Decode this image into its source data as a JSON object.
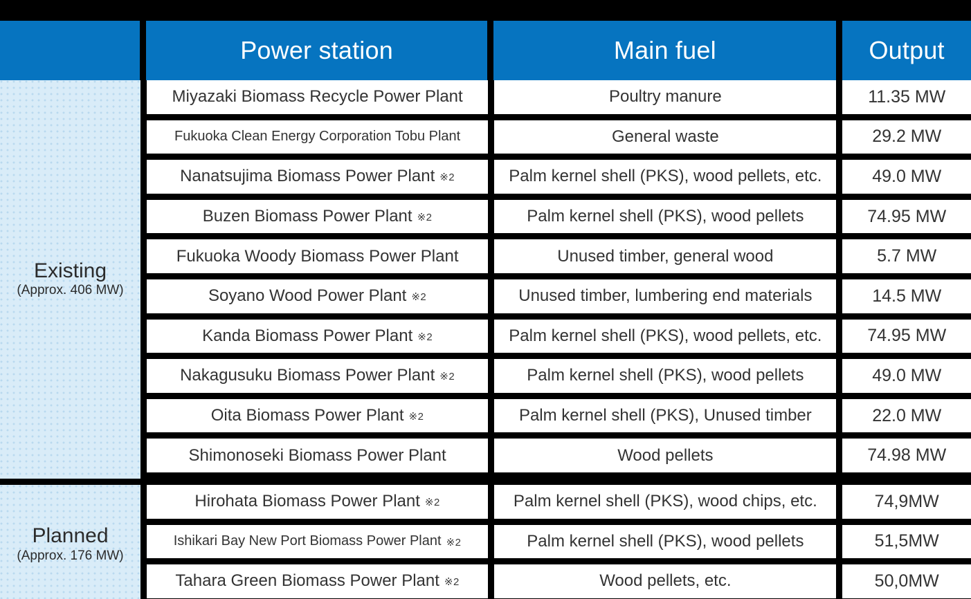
{
  "colors": {
    "header_blue": "#0674c0",
    "group_bg": "#d9ecf8",
    "grid_black": "#000000",
    "text_dark": "#333333"
  },
  "header": {
    "corner_label": "",
    "station_label": "Power station",
    "fuel_label": "Main fuel",
    "output_label": "Output"
  },
  "groups": [
    {
      "id": "existing",
      "name": "Existing",
      "subtitle": "(Approx. 406 MW)",
      "row_count": 10
    },
    {
      "id": "planned",
      "name": "Planned",
      "subtitle": "(Approx. 176 MW)",
      "row_count": 3
    }
  ],
  "rows": [
    {
      "group": "existing",
      "station": "Miyazaki Biomass Recycle Power Plant",
      "note": "",
      "fuel": "Poultry manure",
      "output": "11.35 MW"
    },
    {
      "group": "existing",
      "station": "Fukuoka Clean Energy Corporation Tobu Plant",
      "note": "",
      "fuel": "General waste",
      "output": "29.2 MW"
    },
    {
      "group": "existing",
      "station": "Nanatsujima Biomass Power Plant",
      "note": "※2",
      "fuel": "Palm kernel shell (PKS), wood pellets, etc.",
      "output": "49.0 MW"
    },
    {
      "group": "existing",
      "station": "Buzen Biomass Power Plant",
      "note": "※2",
      "fuel": "Palm kernel shell (PKS), wood pellets",
      "output": "74.95 MW"
    },
    {
      "group": "existing",
      "station": "Fukuoka Woody Biomass Power Plant",
      "note": "",
      "fuel": "Unused timber, general wood",
      "output": "5.7 MW"
    },
    {
      "group": "existing",
      "station": "Soyano Wood Power Plant",
      "note": "※2",
      "fuel": "Unused timber, lumbering end materials",
      "output": "14.5 MW"
    },
    {
      "group": "existing",
      "station": "Kanda Biomass Power Plant",
      "note": "※2",
      "fuel": "Palm kernel shell (PKS), wood pellets, etc.",
      "output": "74.95 MW"
    },
    {
      "group": "existing",
      "station": "Nakagusuku Biomass Power Plant",
      "note": "※2",
      "fuel": "Palm kernel shell (PKS), wood pellets",
      "output": "49.0 MW"
    },
    {
      "group": "existing",
      "station": "Oita Biomass Power Plant",
      "note": "※2",
      "fuel": "Palm kernel shell (PKS), Unused timber",
      "output": "22.0 MW"
    },
    {
      "group": "existing",
      "station": "Shimonoseki Biomass Power Plant",
      "note": "",
      "fuel": "Wood pellets",
      "output": "74.98 MW"
    },
    {
      "group": "planned",
      "station": "Hirohata Biomass Power Plant",
      "note": "※2",
      "fuel": "Palm kernel shell (PKS), wood chips, etc.",
      "output": "74,9MW"
    },
    {
      "group": "planned",
      "station": "Ishikari Bay New Port Biomass Power Plant",
      "note": "※2",
      "fuel": "Palm kernel shell (PKS), wood pellets",
      "output": "51,5MW"
    },
    {
      "group": "planned",
      "station": "Tahara Green Biomass Power Plant",
      "note": "※2",
      "fuel": "Wood pellets, etc.",
      "output": "50,0MW"
    }
  ]
}
